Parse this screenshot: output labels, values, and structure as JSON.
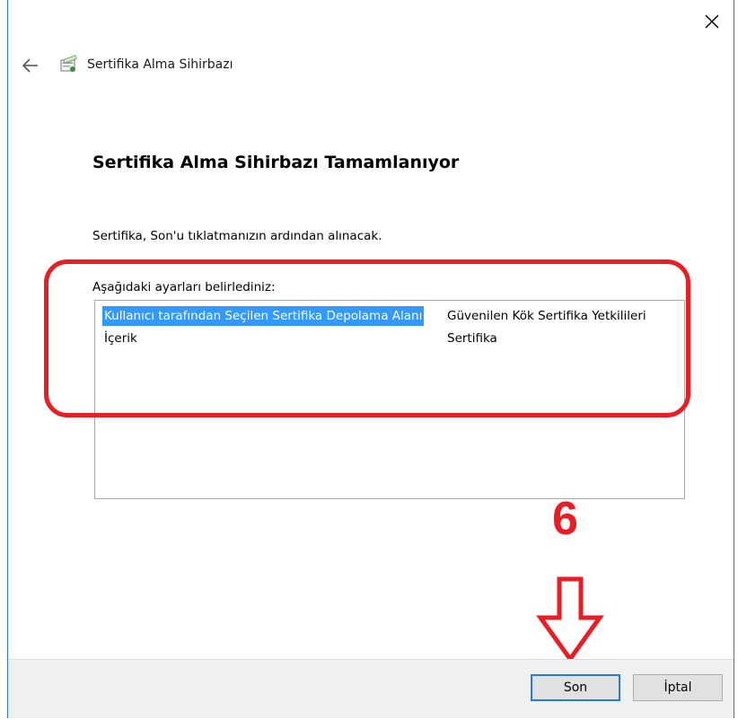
{
  "window": {
    "wizard_title": "Sertifika Alma Sihirbazı",
    "heading": "Sertifika Alma Sihirbazı Tamamlanıyor",
    "intro": "Sertifika, Son'u tıklatmanızın ardından alınacak.",
    "settings_label": "Aşağıdaki ayarları belirlediniz:"
  },
  "settings": [
    {
      "key": "Kullanıcı tarafından Seçilen Sertifika Depolama Alanı",
      "value": "Güvenilen Kök Sertifika Yetkilileri",
      "selected": true
    },
    {
      "key": "İçerik",
      "value": "Sertifika",
      "selected": false
    }
  ],
  "annotation": {
    "step_number": "6",
    "highlight_color": "#ea1c24"
  },
  "buttons": {
    "finish": "Son",
    "cancel": "İptal"
  },
  "icons": {
    "close": "close-icon",
    "back": "back-arrow-icon",
    "wizard": "certificate-wizard-icon"
  }
}
